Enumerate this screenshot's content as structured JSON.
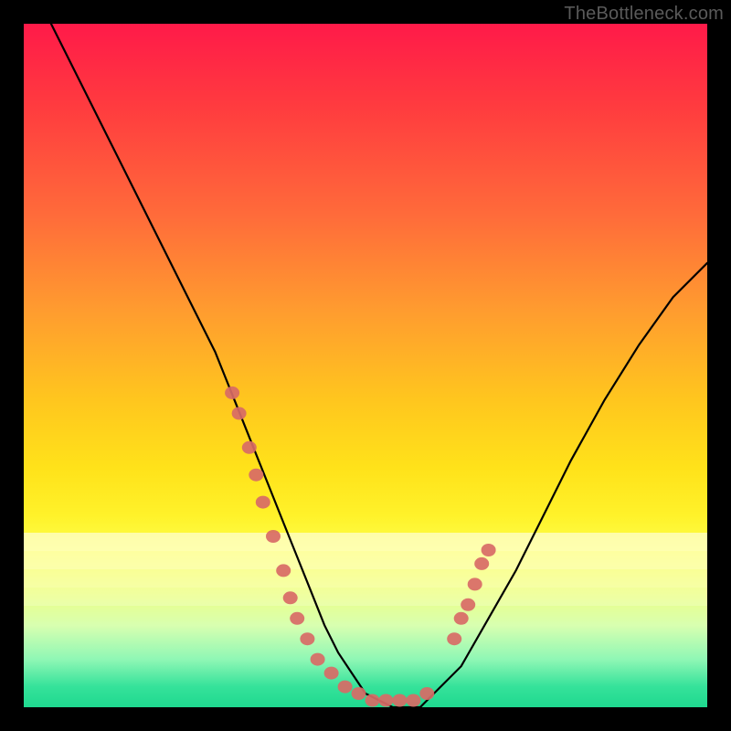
{
  "watermark": "TheBottleneck.com",
  "chart_data": {
    "type": "line",
    "title": "",
    "xlabel": "",
    "ylabel": "",
    "xlim": [
      0,
      100
    ],
    "ylim": [
      0,
      100
    ],
    "series": [
      {
        "name": "curve",
        "x": [
          4,
          8,
          12,
          16,
          20,
          24,
          28,
          30,
          32,
          34,
          36,
          38,
          40,
          42,
          44,
          46,
          48,
          50,
          52,
          54,
          56,
          58,
          60,
          64,
          68,
          72,
          76,
          80,
          85,
          90,
          95,
          100
        ],
        "y": [
          100,
          92,
          84,
          76,
          68,
          60,
          52,
          47,
          42,
          37,
          32,
          27,
          22,
          17,
          12,
          8,
          5,
          2,
          1,
          0,
          0,
          0,
          2,
          6,
          13,
          20,
          28,
          36,
          45,
          53,
          60,
          65
        ]
      }
    ],
    "markers": {
      "name": "highlight-dots",
      "points": [
        {
          "x": 30.5,
          "y": 46
        },
        {
          "x": 31.5,
          "y": 43
        },
        {
          "x": 33.0,
          "y": 38
        },
        {
          "x": 34.0,
          "y": 34
        },
        {
          "x": 35.0,
          "y": 30
        },
        {
          "x": 36.5,
          "y": 25
        },
        {
          "x": 38.0,
          "y": 20
        },
        {
          "x": 39.0,
          "y": 16
        },
        {
          "x": 40.0,
          "y": 13
        },
        {
          "x": 41.5,
          "y": 10
        },
        {
          "x": 43.0,
          "y": 7
        },
        {
          "x": 45.0,
          "y": 5
        },
        {
          "x": 47.0,
          "y": 3
        },
        {
          "x": 49.0,
          "y": 2
        },
        {
          "x": 51.0,
          "y": 1
        },
        {
          "x": 53.0,
          "y": 1
        },
        {
          "x": 55.0,
          "y": 1
        },
        {
          "x": 57.0,
          "y": 1
        },
        {
          "x": 59.0,
          "y": 2
        },
        {
          "x": 63.0,
          "y": 10
        },
        {
          "x": 64.0,
          "y": 13
        },
        {
          "x": 65.0,
          "y": 15
        },
        {
          "x": 66.0,
          "y": 18
        },
        {
          "x": 67.0,
          "y": 21
        },
        {
          "x": 68.0,
          "y": 23
        }
      ]
    },
    "background_gradient": [
      "#ff1a49",
      "#ff6b3a",
      "#ffc61e",
      "#fff22a",
      "#8ff7b5",
      "#1fd98f"
    ]
  }
}
